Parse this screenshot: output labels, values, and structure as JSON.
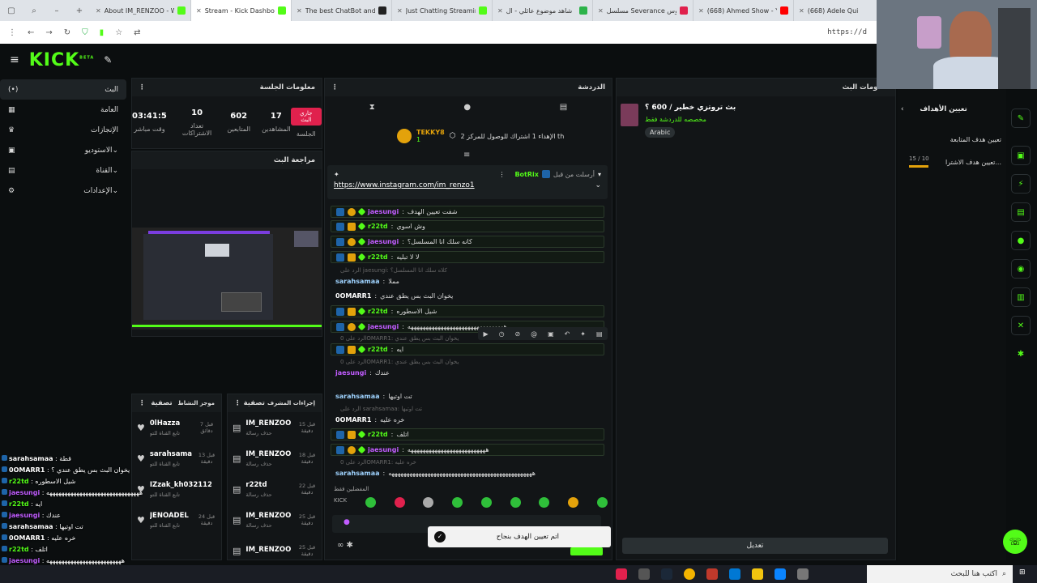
{
  "browser": {
    "tabs": [
      {
        "title": "About IM_RENZOO - W",
        "color": "#53fc18"
      },
      {
        "title": "Stream - Kick Dashboa",
        "color": "#53fc18"
      },
      {
        "title": "The best ChatBot and V",
        "color": "#222222"
      },
      {
        "title": "Just Chatting Streaming",
        "color": "#53fc18"
      },
      {
        "title": "شاهد موضوع عائلي - ال",
        "color": "#2db34a"
      },
      {
        "title": "مسلسل Severance الموس",
        "color": "#e0214d"
      },
      {
        "title": "(668) Ahmed Show - Yo",
        "color": "#ff0000"
      },
      {
        "title": "(668) Adele Qui",
        "color": "#ff0000"
      }
    ],
    "url": "https://d"
  },
  "sidebar": {
    "items": [
      {
        "label": "البث",
        "icon": "broadcast-icon"
      },
      {
        "label": "العامة",
        "icon": "home-icon"
      },
      {
        "label": "الإنجازات",
        "icon": "trophy-icon"
      },
      {
        "label": "الاستوديو",
        "icon": "studio-icon"
      },
      {
        "label": "القناة",
        "icon": "channel-icon"
      },
      {
        "label": "الإعدادات",
        "icon": "gear-icon"
      }
    ]
  },
  "session": {
    "title": "معلومات الجلسة",
    "live_label": "جاري البث",
    "session_label": "الجلسة",
    "stats": [
      {
        "value": "17",
        "label": "المشاهدين"
      },
      {
        "value": "602",
        "label": "المتابعين"
      },
      {
        "value": "10",
        "label": "تعداد الاشتراكات"
      },
      {
        "value": "03:41:5",
        "label": "وقت مباشر"
      }
    ]
  },
  "review": {
    "title": "مراجعة البث"
  },
  "feed": {
    "title": "موجز النشاط",
    "filter": "تصفية",
    "items": [
      {
        "name": "0lHazza",
        "sub": "تابع القناة للتو",
        "time": "قبل 7 دقائق"
      },
      {
        "name": "sarahsamaa",
        "sub": "تابع القناة للتو",
        "time": "قبل 13 دقيقة"
      },
      {
        "name": "IZzak_kh0321122",
        "sub": "تابع القناة للتو",
        "time": ""
      },
      {
        "name": "JENOADEL",
        "sub": "تابع القناة للتو",
        "time": "قبل 24 دقيقة"
      }
    ]
  },
  "mod": {
    "title": "إجراءات المشرف",
    "filter": "تصفية",
    "items": [
      {
        "name": "IM_RENZOO",
        "sub": "حذف رسالة",
        "time": "قبل 15 دقيقة"
      },
      {
        "name": "IM_RENZOO",
        "sub": "حذف رسالة",
        "time": "قبل 18 دقيقة"
      },
      {
        "name": "r22td",
        "sub": "حذف رسالة",
        "time": "قبل 22 دقيقة"
      },
      {
        "name": "IM_RENZOO",
        "sub": "حذف رسالة",
        "time": "قبل 25 دقيقة"
      },
      {
        "name": "IM_RENZOO",
        "sub": "",
        "time": "قبل 25 دقيقة"
      }
    ]
  },
  "chat": {
    "title": "الدردشة",
    "goal_user": "TEKKY8",
    "goal_count": "1",
    "goal_text": "الإهداء 1 اشتراك للوصول للمركز 2 th",
    "pinned_by": "أرسلت من قبل",
    "pinned_user": "BotRix",
    "pinned_link": "https://www.instagram.com/im_renzo1",
    "messages": [
      {
        "user": "jaesungi",
        "text": "شفت تعيين الهدف",
        "color": "#c15cff",
        "boxed": true
      },
      {
        "user": "r22td",
        "text": "وش اسوي",
        "color": "#53fc18",
        "boxed": true
      },
      {
        "user": "jaesungi",
        "text": "كانه سلك انا المسلسل؟",
        "color": "#c15cff",
        "boxed": true
      },
      {
        "user": "r22td",
        "text": "لا لا تبليه",
        "color": "#53fc18",
        "boxed": true
      },
      {
        "user": "sarahsamaa",
        "text": "مملا",
        "color": "#9fd3ff",
        "boxed": false,
        "reply": "الرد على jaesungi: كلاه سلك انا المسلسل؟"
      },
      {
        "user": "0OMARR1",
        "text": "يخوان البث بس يطق عندي",
        "color": "#ffffff",
        "boxed": false
      },
      {
        "user": "r22td",
        "text": "شيل الاسطوره",
        "color": "#53fc18",
        "boxed": true
      },
      {
        "user": "jaesungi",
        "text": "ههههههههههههههههههههههههههههههههه",
        "color": "#c15cff",
        "boxed": true
      },
      {
        "user": "r22td",
        "text": "ايه",
        "color": "#53fc18",
        "boxed": true,
        "reply": "الرد على 0OMARR1: يخوان البث بس يطق عندي"
      },
      {
        "user": "jaesungi",
        "text": "عندك",
        "color": "#c15cff",
        "boxed": false,
        "reply": "الرد على 0OMARR1: يخوان البث بس يطق عندي"
      },
      {
        "user": "sarahsamaa",
        "text": "تت اوتيها",
        "color": "#9fd3ff",
        "boxed": false
      },
      {
        "user": "0OMARR1",
        "text": "خره عليه",
        "color": "#ffffff",
        "boxed": false,
        "reply": "الرد على sarahsamaa: تت اوتيها"
      },
      {
        "user": "r22td",
        "text": "اتلف",
        "color": "#53fc18",
        "boxed": true
      },
      {
        "user": "jaesungi",
        "text": "ههههههههههههههههههههههههههه",
        "color": "#c15cff",
        "boxed": true
      },
      {
        "user": "sarahsamaa",
        "text": "ههههههههههههههههههههههههههههههههههههههههههههههههه",
        "color": "#9fd3ff",
        "boxed": false,
        "reply": "الرد على 0OMARR1: خره عليه"
      }
    ],
    "emotes_label": "المفضلين فقط",
    "toast": "اتم تعيين الهدف بنجاح"
  },
  "stream_info": {
    "title": "معلومات البث",
    "stream_title": "بث تروتزي خطير / 600 ؟",
    "tag": "مخصصه للدردشة فقط",
    "language": "Arabic",
    "edit_label": "تعديل"
  },
  "goals": {
    "title": "تعيين الأهداف",
    "items": [
      {
        "label": "تعيين هدف المتابعة",
        "progress": ""
      },
      {
        "label": "تعيين هدف الاشترا...",
        "progress": "15 / 10"
      }
    ]
  },
  "overlay_chat": [
    {
      "user": "sarahsamaa",
      "text": "قطة"
    },
    {
      "user": "0OMARR1",
      "text": "يخوان البث بس يطق عندي ؟"
    },
    {
      "user": "r22td",
      "text": "شيل الاسطوره"
    },
    {
      "user": "jaesungi",
      "text": "هههههههههههههههههههههههههههههههه"
    },
    {
      "user": "r22td",
      "text": "ايه"
    },
    {
      "user": "jaesungi",
      "text": "عندك"
    },
    {
      "user": "sarahsamaa",
      "text": "تت اوتيها"
    },
    {
      "user": "0OMARR1",
      "text": "خره عليه"
    },
    {
      "user": "r22td",
      "text": "اتلف"
    },
    {
      "user": "jaesungi",
      "text": "هههههههههههههههههههههههههه"
    },
    {
      "user": "sarahsamaa",
      "text": "هههههههههههههههههههههههههههههههههههههه"
    }
  ],
  "taskbar": {
    "search_placeholder": "اكتب هنا للبحث"
  },
  "colors": {
    "accent": "#53fc18",
    "live": "#e0214d",
    "bg": "#0b0e0f"
  }
}
